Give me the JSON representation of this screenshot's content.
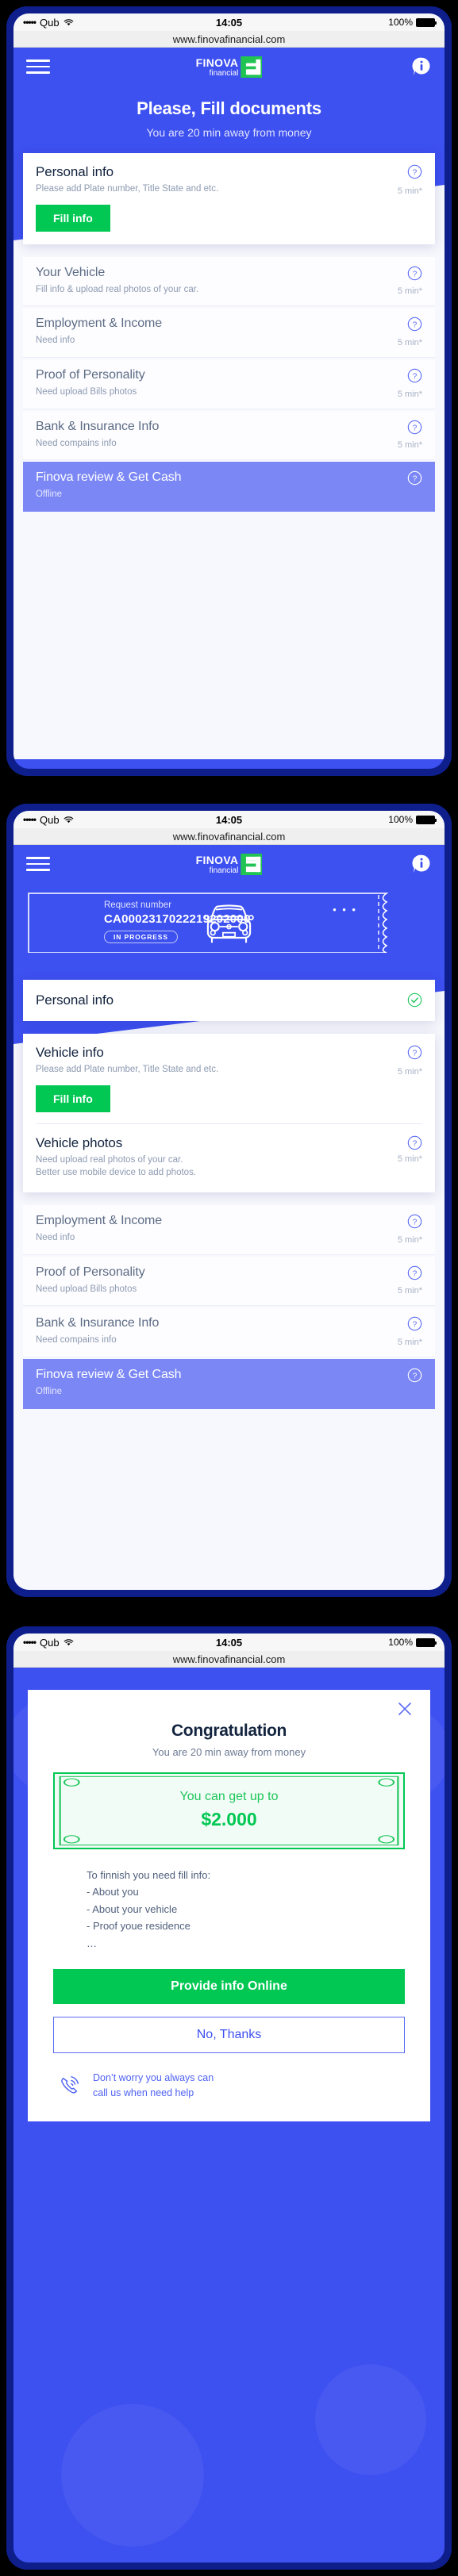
{
  "statusbar": {
    "signal_dots": "•••••",
    "carrier": "Qub",
    "time": "14:05",
    "battery_percent": "100%"
  },
  "browser": {
    "url": "www.finovafinancial.com"
  },
  "brand": {
    "name": "FINOVA",
    "tagline": "financial",
    "accent_green": "#00c853",
    "accent_blue": "#3d50f0"
  },
  "screen1": {
    "hero_title": "Please, Fill documents",
    "hero_subtitle": "You are 20 min away from money",
    "active_card": {
      "title": "Personal info",
      "subtitle": "Please add Plate number, Title State and etc.",
      "time": "5 min*",
      "button": "Fill info"
    },
    "steps": [
      {
        "title": "Your Vehicle",
        "subtitle": "Fill info & upload real photos of your car.",
        "time": "5 min*",
        "state": "pending"
      },
      {
        "title": "Employment & Income",
        "subtitle": "Need info",
        "time": "5 min*",
        "state": "pending"
      },
      {
        "title": "Proof of Personality",
        "subtitle": "Need upload Bills photos",
        "time": "5 min*",
        "state": "pending"
      },
      {
        "title": "Bank & Insurance Info",
        "subtitle": "Need compains info",
        "time": "5 min*",
        "state": "pending"
      },
      {
        "title": "Finova review & Get Cash",
        "subtitle": "Offline",
        "time": "",
        "state": "offline"
      }
    ]
  },
  "screen2": {
    "ticket": {
      "label": "Request number",
      "number": "CA0002317022219202000",
      "status_badge": "IN PROGRESS",
      "menu_dots": "• • •"
    },
    "done_card": {
      "title": "Personal info"
    },
    "active_card": {
      "title": "Vehicle info",
      "subtitle": "Please add Plate number, Title State and etc.",
      "time": "5 min*",
      "button": "Fill info",
      "second_title": "Vehicle photos",
      "second_subtitle_l1": "Need upload real photos of your car.",
      "second_subtitle_l2": "Better use mobile device to add photos.",
      "second_time": "5 min*"
    },
    "steps": [
      {
        "title": "Employment & Income",
        "subtitle": "Need info",
        "time": "5 min*",
        "state": "pending"
      },
      {
        "title": "Proof of Personality",
        "subtitle": "Need upload Bills photos",
        "time": "5 min*",
        "state": "pending"
      },
      {
        "title": "Bank & Insurance Info",
        "subtitle": "Need compains info",
        "time": "5 min*",
        "state": "pending"
      },
      {
        "title": "Finova review & Get Cash",
        "subtitle": "Offline",
        "time": "",
        "state": "offline"
      }
    ]
  },
  "screen3": {
    "modal": {
      "title": "Congratulation",
      "subtitle": "You are 20 min away from money",
      "note_line1": "You can get up to",
      "note_amount": "$2.000",
      "list_heading": "To finnish you need fill info:",
      "list_items": [
        "- About you",
        "- About your vehicle",
        "- Proof youe residence",
        "…"
      ],
      "primary_button": "Provide info Online",
      "secondary_button": "No, Thanks",
      "call_note_l1": "Don’t worry you always can",
      "call_note_l2": "call us when need help"
    }
  }
}
